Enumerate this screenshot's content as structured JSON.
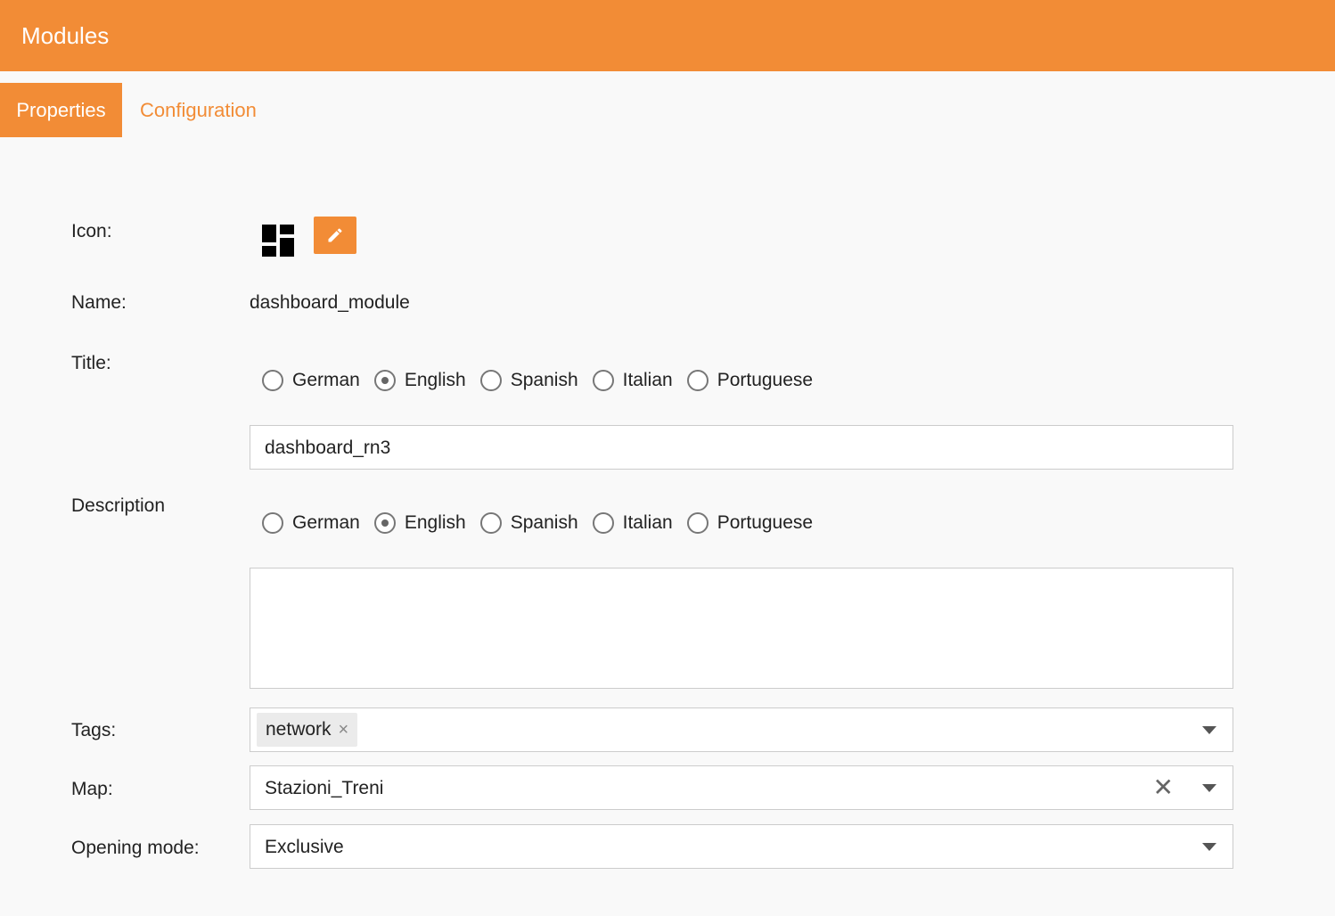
{
  "header": {
    "title": "Modules",
    "color": "#f28c36"
  },
  "tabs": [
    {
      "label": "Properties",
      "active": true
    },
    {
      "label": "Configuration",
      "active": false
    }
  ],
  "form": {
    "icon": {
      "label": "Icon:",
      "icon_name": "dashboard-icon"
    },
    "name": {
      "label": "Name:",
      "value": "dashboard_module"
    },
    "title": {
      "label": "Title:",
      "languages": [
        "German",
        "English",
        "Spanish",
        "Italian",
        "Portuguese"
      ],
      "selected_language": "English",
      "value": "dashboard_rn3"
    },
    "description": {
      "label": "Description",
      "languages": [
        "German",
        "English",
        "Spanish",
        "Italian",
        "Portuguese"
      ],
      "selected_language": "English",
      "value": ""
    },
    "tags": {
      "label": "Tags:",
      "items": [
        "network"
      ],
      "remove_glyph": "×"
    },
    "map": {
      "label": "Map:",
      "value": "Stazioni_Treni",
      "clear_glyph": "✕"
    },
    "opening_mode": {
      "label": "Opening mode:",
      "value": "Exclusive"
    }
  }
}
